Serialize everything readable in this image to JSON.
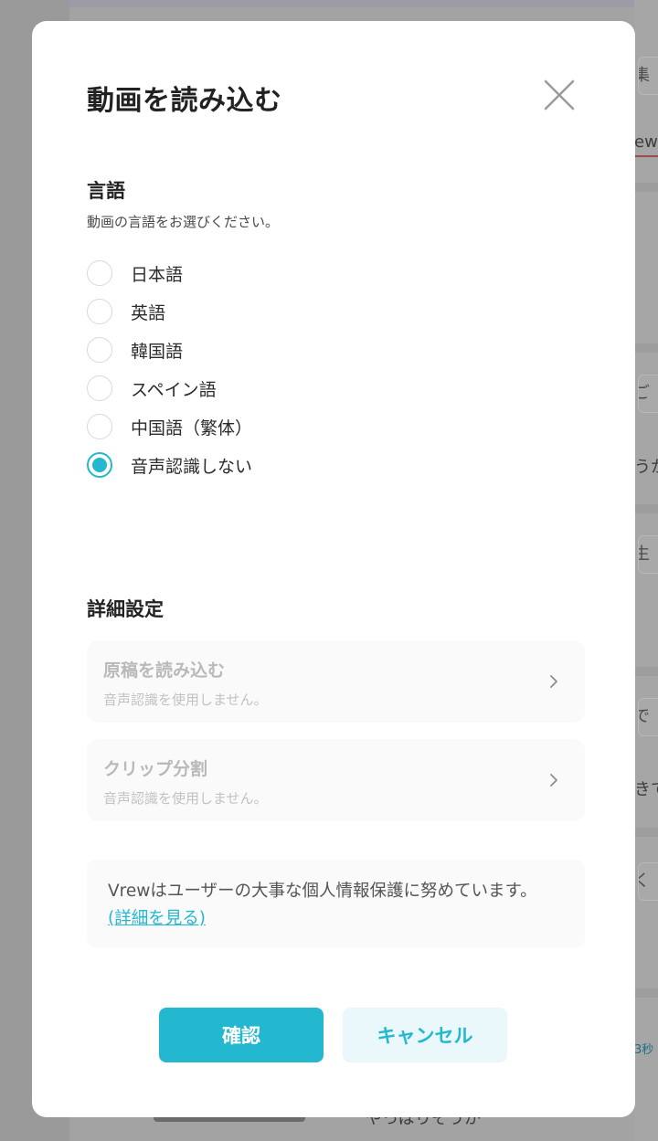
{
  "background": {
    "right_fragments": [
      {
        "text": "集"
      },
      {
        "text": "ew"
      },
      {
        "text": "ご"
      },
      {
        "text": "うか"
      },
      {
        "text": "生"
      },
      {
        "text": "で"
      },
      {
        "text": "きて"
      },
      {
        "text": "く"
      },
      {
        "text": "3秒"
      }
    ],
    "bottom_text": "やっぱりそうか"
  },
  "modal": {
    "title": "動画を読み込む",
    "language": {
      "title": "言語",
      "description": "動画の言語をお選びください。",
      "options": [
        {
          "label": "日本語",
          "checked": false
        },
        {
          "label": "英語",
          "checked": false
        },
        {
          "label": "韓国語",
          "checked": false
        },
        {
          "label": "スペイン語",
          "checked": false
        },
        {
          "label": "中国語（繁体）",
          "checked": false
        },
        {
          "label": "音声認識しない",
          "checked": true
        }
      ]
    },
    "advanced": {
      "title": "詳細設定",
      "cards": [
        {
          "title": "原稿を読み込む",
          "subtitle": "音声認識を使用しません。"
        },
        {
          "title": "クリップ分割",
          "subtitle": "音声認識を使用しません。"
        }
      ]
    },
    "privacy": {
      "text": "Vrewはユーザーの大事な個人情報保護に努めています。",
      "link": "(詳細を見る)"
    },
    "buttons": {
      "confirm": "確認",
      "cancel": "キャンセル"
    }
  },
  "colors": {
    "accent": "#23b8cf",
    "overlay": "#9b9b9b"
  }
}
